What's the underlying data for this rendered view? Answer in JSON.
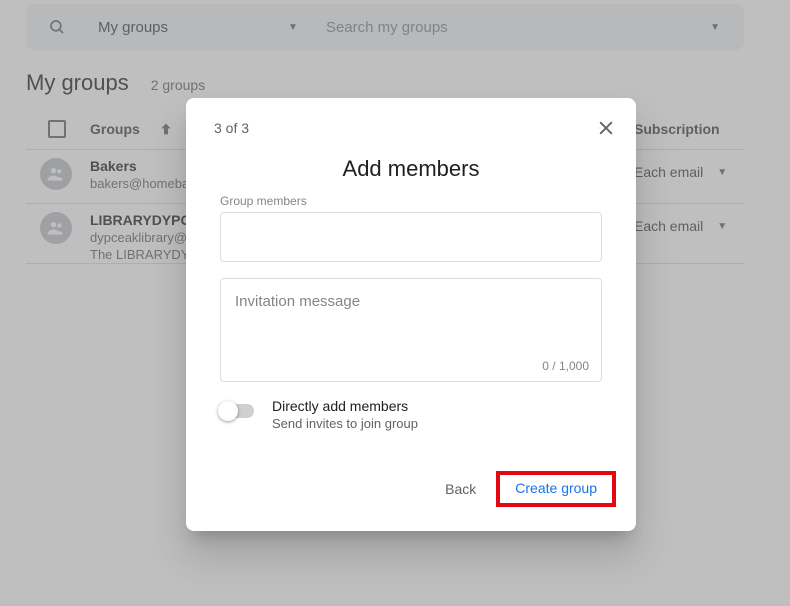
{
  "search": {
    "scope": "My groups",
    "placeholder": "Search my groups"
  },
  "page": {
    "title": "My groups",
    "count_label": "2 groups"
  },
  "columns": {
    "groups": "Groups",
    "subscription": "Subscription"
  },
  "rows": [
    {
      "name": "Bakers",
      "email": "bakers@homebak",
      "desc": "",
      "subscription": "Each email"
    },
    {
      "name": "LIBRARYDYPCE",
      "email": "dypceaklibrary@g",
      "desc": "The LIBRARYDYP",
      "subscription": "Each email"
    }
  ],
  "dialog": {
    "step": "3 of 3",
    "title": "Add members",
    "members_label": "Group members",
    "invitation_placeholder": "Invitation message",
    "char_counter": "0 / 1,000",
    "toggle_title": "Directly add members",
    "toggle_sub": "Send invites to join group",
    "back": "Back",
    "create": "Create group"
  }
}
